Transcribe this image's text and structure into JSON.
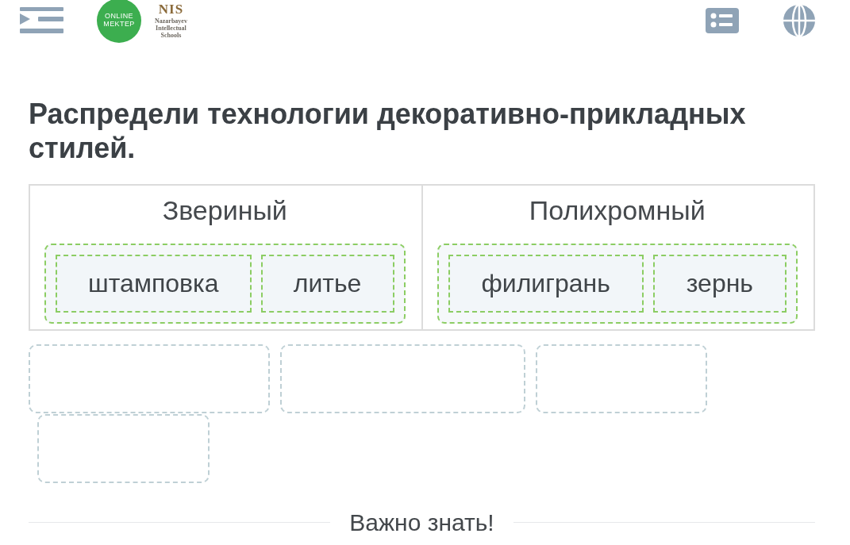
{
  "header": {
    "online_mektep_logo": [
      "ONLINE",
      "MEKTEP"
    ],
    "nis_logo": {
      "mark": "NIS",
      "caption": [
        "Nazarbayev",
        "Intellectual",
        "Schools"
      ]
    }
  },
  "task": {
    "title": "Распредели технологии декоративно-прикладных стилей.",
    "categories": [
      {
        "label": "Звериный",
        "items": [
          {
            "text": "штамповка",
            "correct": true
          },
          {
            "text": "литье",
            "correct": true
          }
        ]
      },
      {
        "label": "Полихромный",
        "items": [
          {
            "text": "филигрань",
            "correct": true
          },
          {
            "text": "зернь",
            "correct": true
          }
        ]
      }
    ],
    "answer_bank": [
      {
        "kind": "empty"
      },
      {
        "kind": "empty"
      },
      {
        "kind": "empty"
      },
      {
        "kind": "empty"
      }
    ]
  },
  "section_heading": "Важно знать!"
}
